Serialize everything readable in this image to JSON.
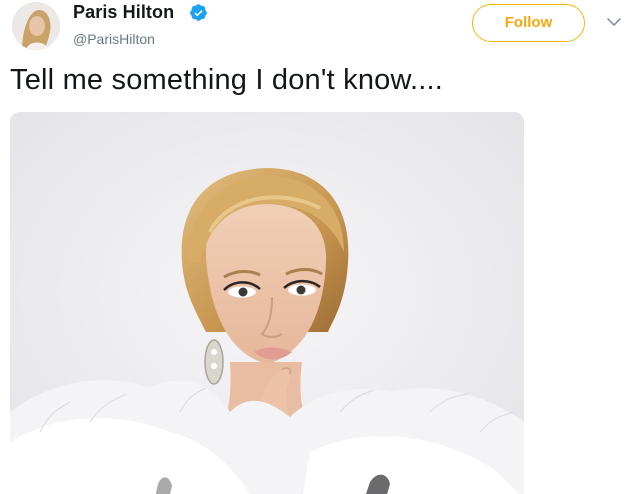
{
  "user": {
    "display_name": "Paris Hilton",
    "handle": "@ParisHilton",
    "verified": true
  },
  "follow_button": {
    "label": "Follow"
  },
  "tweet": {
    "text": "Tell me something I don't know...."
  },
  "colors": {
    "follow_accent": "#f5a80f",
    "verified_badge": "#1da1f2",
    "name_text": "#14171a",
    "handle_text": "#657786"
  },
  "icons": {
    "verified": "verified-badge-icon",
    "caret": "chevron-down-icon"
  }
}
